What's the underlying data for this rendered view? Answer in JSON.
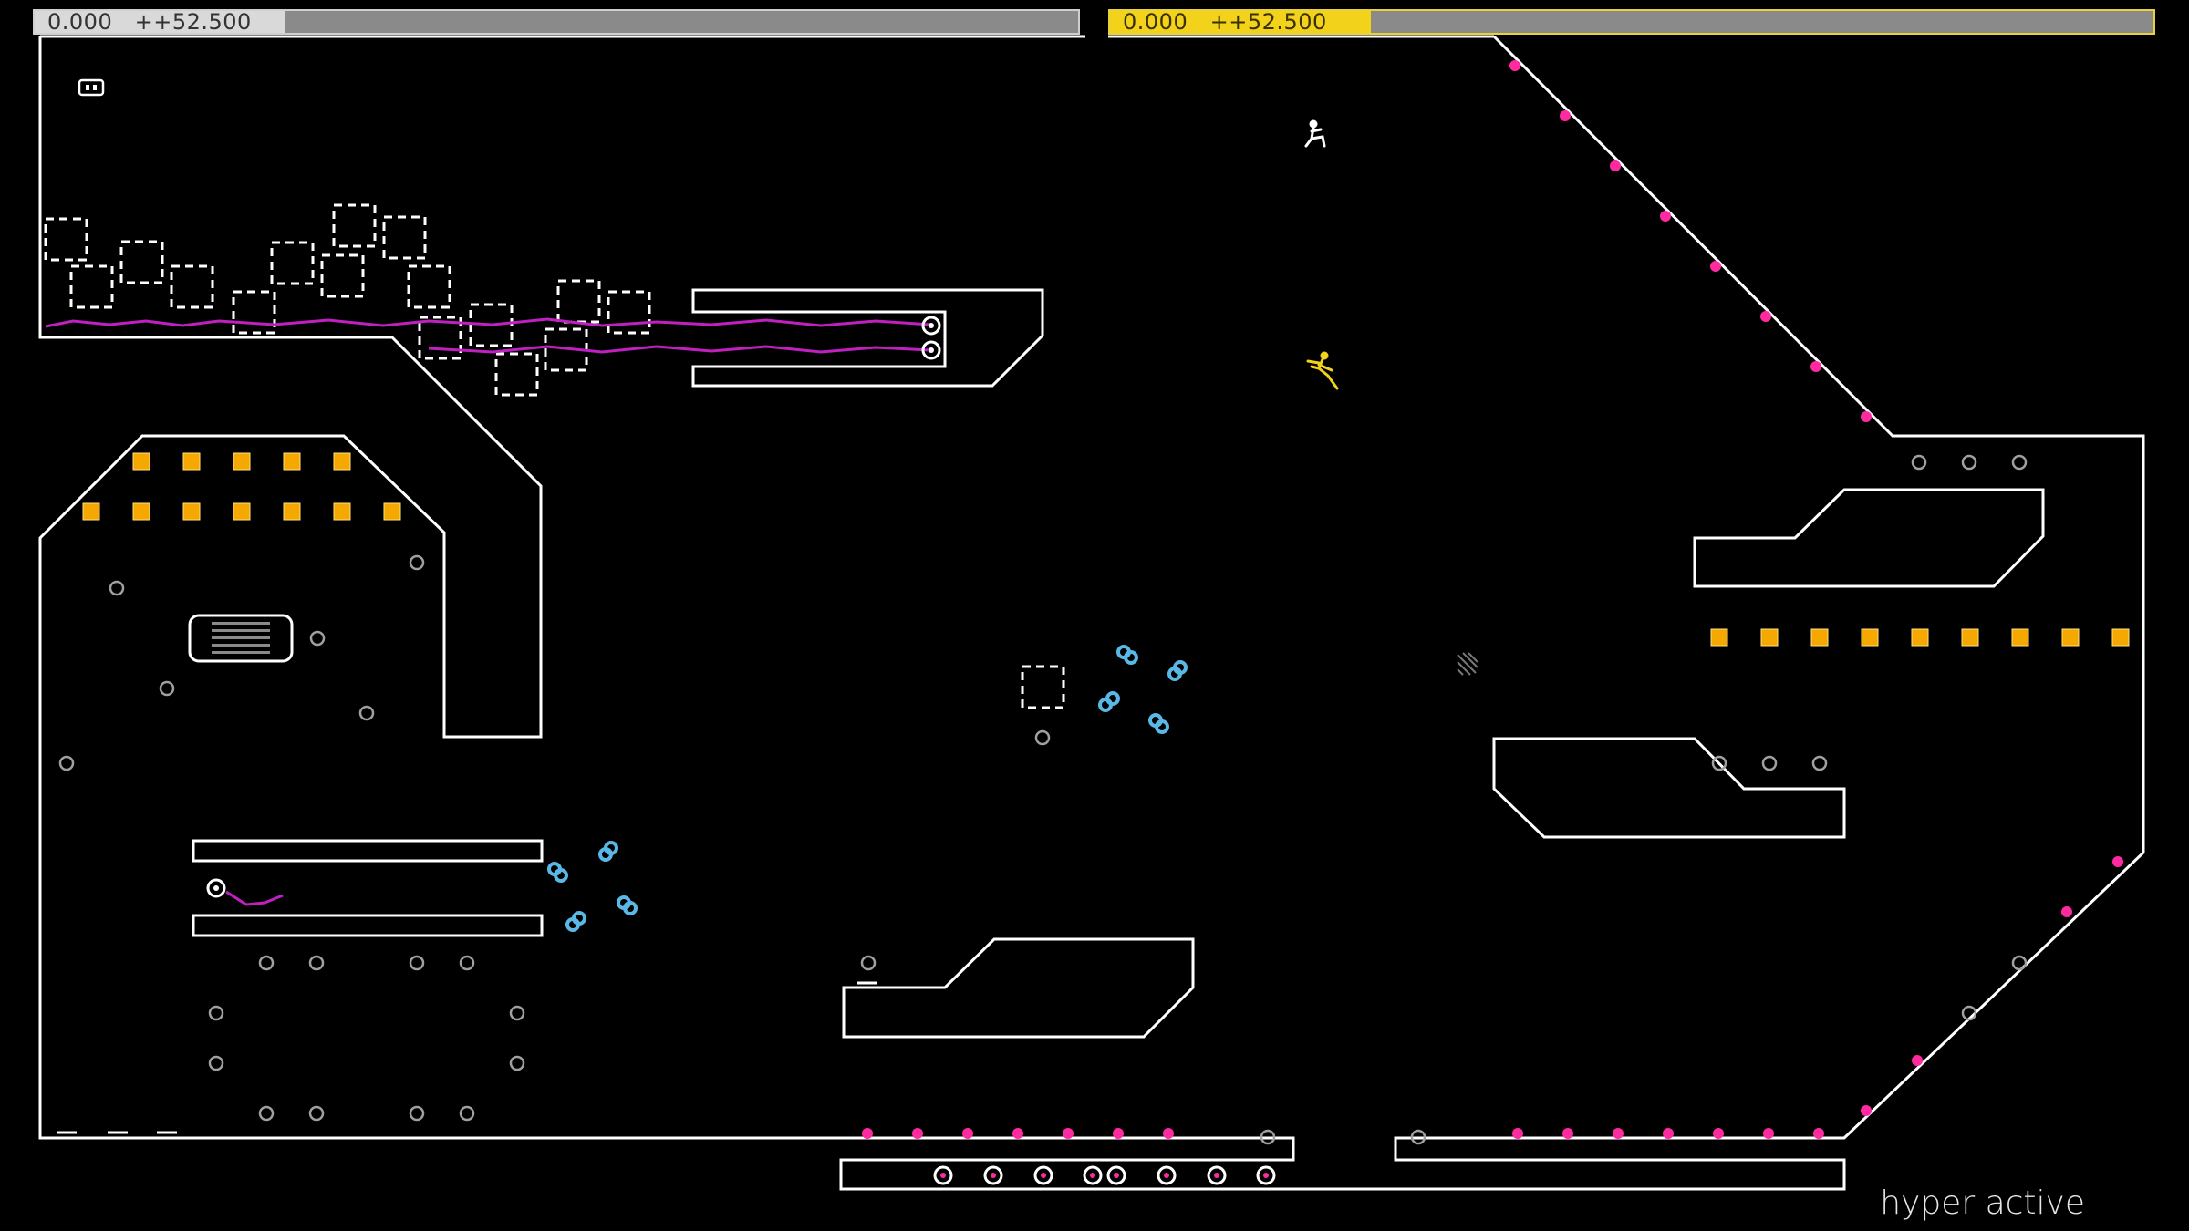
{
  "hud": {
    "player1": {
      "time": "0.000",
      "bonus": "++52.500",
      "accent": "#d9d9d9",
      "progress": 0.24
    },
    "player2": {
      "time": "0.000",
      "bonus": "++52.500",
      "accent": "#f2d21b",
      "progress": 0.25
    }
  },
  "level": {
    "name": "hyper active"
  },
  "colors": {
    "wall": "#ffffff",
    "gold": "#f5a800",
    "mine": "#ff2aa0",
    "laser": "#c020c0",
    "drone": "#5ab8e6",
    "ninja_p1": "#ffffff",
    "ninja_p2": "#f2d21b",
    "switch": "#a0a0a0"
  }
}
